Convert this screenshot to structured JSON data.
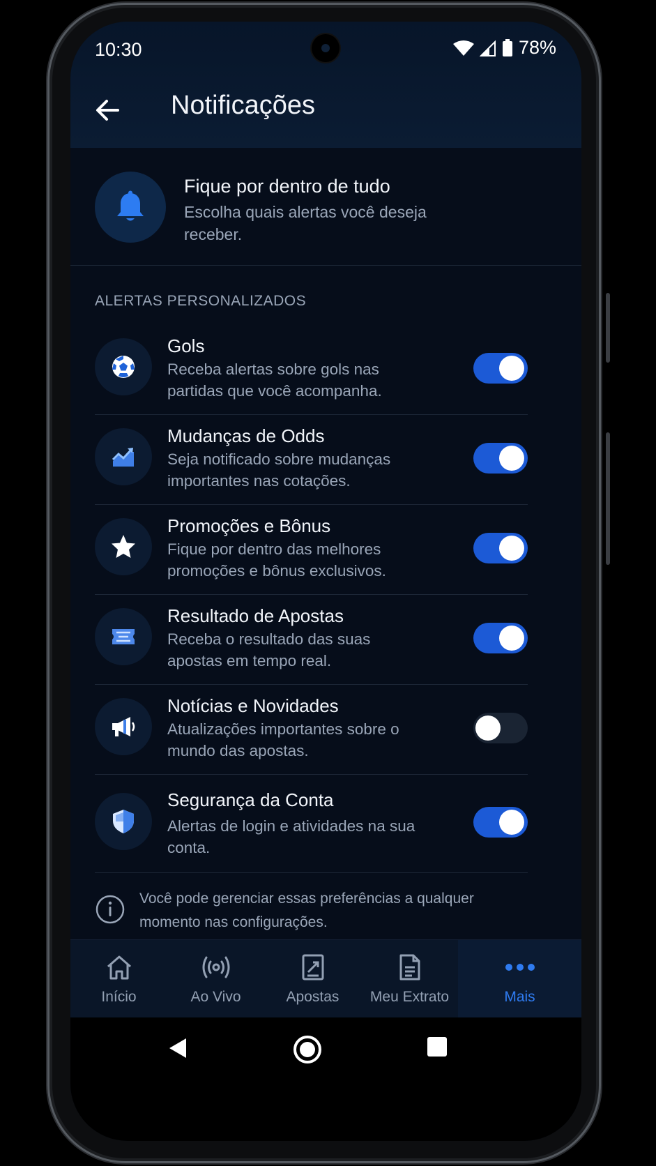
{
  "status_bar": {
    "time": "10:30",
    "battery": "78%"
  },
  "header": {
    "title": "Notificações"
  },
  "intro": {
    "title": "Fique por dentro de tudo",
    "subtitle": "Escolha quais alertas você deseja receber."
  },
  "section_label": "ALERTAS PERSONALIZADOS",
  "alerts": [
    {
      "title": "Gols",
      "desc": "Receba alertas sobre gols nas partidas que você acompanha.",
      "icon": "soccer-ball-icon",
      "enabled": true
    },
    {
      "title": "Mudanças de Odds",
      "desc": "Seja notificado sobre mudanças importantes nas cotações.",
      "icon": "trend-chart-icon",
      "enabled": true
    },
    {
      "title": "Promoções e Bônus",
      "desc": "Fique por dentro das melhores promoções e bônus exclusivos.",
      "icon": "star-icon",
      "enabled": true
    },
    {
      "title": "Resultado de Apostas",
      "desc": "Receba o resultado das suas apostas em tempo real.",
      "icon": "ticket-icon",
      "enabled": true
    },
    {
      "title": "Notícias e Novidades",
      "desc": "Atualizações importantes sobre o mundo das apostas.",
      "icon": "megaphone-icon",
      "enabled": false
    },
    {
      "title": "Segurança da Conta",
      "desc": "Alertas de login e atividades na sua conta.",
      "icon": "shield-icon",
      "enabled": true
    }
  ],
  "info_text": "Você pode gerenciar essas preferências a qualquer momento nas configurações.",
  "bottom_nav": [
    {
      "label": "Início",
      "icon": "home-icon",
      "active": false
    },
    {
      "label": "Ao Vivo",
      "icon": "live-broadcast-icon",
      "active": false
    },
    {
      "label": "Apostas",
      "icon": "bet-slip-icon",
      "active": false
    },
    {
      "label": "Meu Extrato",
      "icon": "document-icon",
      "active": false
    },
    {
      "label": "Mais",
      "icon": "more-dots-icon",
      "active": true
    }
  ],
  "colors": {
    "accent": "#2f7bf0",
    "toggle_on": "#1c5ad6",
    "background": "#060d1a"
  }
}
